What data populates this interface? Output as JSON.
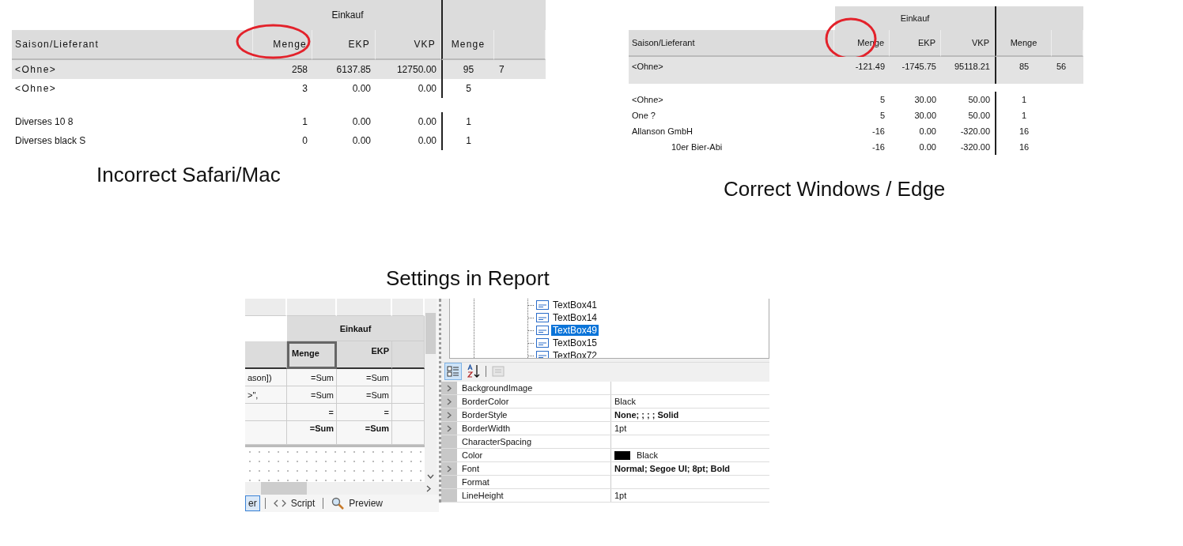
{
  "incorrect_view": {
    "kind": "mac",
    "group_header": "Einkauf",
    "columns": [
      {
        "label": "Saison/Lieferant",
        "circled": false
      },
      {
        "label": "Menge",
        "circled": true
      },
      {
        "label": "EKP",
        "circled": false
      },
      {
        "label": "VKP",
        "circled": false
      },
      {
        "label": "Menge",
        "circled": false
      }
    ],
    "rows": [
      {
        "cells": [
          "<Ohne>",
          "258",
          "6137.85",
          "12750.00",
          "95",
          "7"
        ],
        "shaded": true,
        "indented": false
      },
      {
        "cells": [
          "<Ohne>",
          "3",
          "0.00",
          "0.00",
          "5"
        ],
        "shaded": false,
        "indented": false
      },
      {
        "cells": [
          "Diverses 10 8",
          "1",
          "0.00",
          "0.00",
          "1"
        ],
        "shaded": false,
        "indented": false
      },
      {
        "cells": [
          "Diverses black S",
          "0",
          "0.00",
          "0.00",
          "1"
        ],
        "shaded": false,
        "indented": false
      }
    ],
    "caption": "Incorrect Safari/Mac"
  },
  "correct_view": {
    "kind": "windows",
    "group_header": "Einkauf",
    "columns": [
      {
        "label": "Saison/Lieferant",
        "circled": false
      },
      {
        "label": "Menge",
        "circled": true
      },
      {
        "label": "EKP",
        "circled": false
      },
      {
        "label": "VKP",
        "circled": false
      },
      {
        "label": "Menge",
        "circled": false
      }
    ],
    "rows": [
      {
        "cells": [
          "<Ohne>",
          "-121.49",
          "-1745.75",
          "95118.21",
          "85",
          "56"
        ],
        "shaded": true,
        "indented": false
      },
      {
        "cells": [
          "<Ohne>",
          "5",
          "30.00",
          "50.00",
          "1"
        ],
        "shaded": false,
        "indented": false
      },
      {
        "cells": [
          "One ?",
          "5",
          "30.00",
          "50.00",
          "1"
        ],
        "shaded": false,
        "indented": false
      },
      {
        "cells": [
          "Allanson GmbH",
          "-16",
          "0.00",
          "-320.00",
          "16"
        ],
        "shaded": false,
        "indented": false
      },
      {
        "cells": [
          "10er Bier-Abi",
          "-16",
          "0.00",
          "-320.00",
          "16"
        ],
        "shaded": false,
        "indented": true
      }
    ],
    "caption": "Correct Windows / Edge"
  },
  "settings_view": {
    "caption": "Settings in Report",
    "designer": {
      "group_header": "Einkauf",
      "columns": [
        {
          "label": "Menge",
          "selected": true
        },
        {
          "label": "EKP",
          "selected": false
        }
      ],
      "rows": [
        {
          "label": "ason])",
          "values": [
            "=Sum",
            "=Sum"
          ]
        },
        {
          "label": ">\",",
          "values": [
            "=Sum",
            "=Sum"
          ]
        },
        {
          "values": [
            "=",
            "="
          ]
        },
        {
          "values": [
            "=Sum",
            "=Sum"
          ]
        }
      ],
      "tabs": [
        {
          "kind": "designer",
          "label": "er",
          "selected": true
        },
        {
          "kind": "script",
          "label": "Script",
          "selected": false
        },
        {
          "kind": "preview",
          "label": "Preview",
          "selected": false
        }
      ]
    },
    "tree": [
      {
        "label": "TextBox41",
        "selected": false
      },
      {
        "label": "TextBox14",
        "selected": false
      },
      {
        "label": "TextBox49",
        "selected": true
      },
      {
        "label": "TextBox15",
        "selected": false
      },
      {
        "label": "TextBox72",
        "selected": false
      }
    ],
    "toolbar": [
      {
        "kind": "categorized",
        "selected": true,
        "disabled": false
      },
      {
        "kind": "alphabetical",
        "selected": false,
        "disabled": false
      },
      {
        "kind": "pages",
        "selected": false,
        "disabled": true
      }
    ],
    "properties": [
      {
        "name": "BackgroundImage",
        "expandable": true
      },
      {
        "name": "BorderColor",
        "value": "Black",
        "expandable": true,
        "bold": false
      },
      {
        "name": "BorderStyle",
        "value": "None; ; ; ; Solid",
        "expandable": true,
        "bold": true
      },
      {
        "name": "BorderWidth",
        "value": "1pt",
        "expandable": true,
        "bold": false
      },
      {
        "name": "CharacterSpacing",
        "expandable": false
      },
      {
        "name": "Color",
        "value": "Black",
        "color": "#000000",
        "expandable": false,
        "bold": false
      },
      {
        "name": "Font",
        "value": "Normal; Segoe UI; 8pt; Bold",
        "expandable": true,
        "bold": true
      },
      {
        "name": "Format",
        "expandable": false
      },
      {
        "name": "LineHeight",
        "value": "1pt",
        "expandable": false,
        "bold": false
      }
    ]
  }
}
